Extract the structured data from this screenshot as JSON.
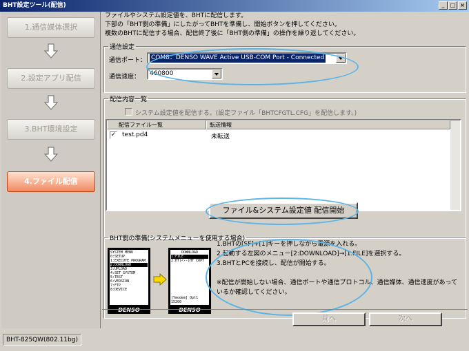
{
  "window": {
    "title": "BHT設定ツール(配信)"
  },
  "titlebar_buttons": [
    "_",
    "□",
    "×"
  ],
  "steps": [
    {
      "label": "1.通信媒体選択",
      "active": false
    },
    {
      "label": "2.設定アプリ配信",
      "active": false
    },
    {
      "label": "3.BHT環境設定",
      "active": false
    },
    {
      "label": "4.ファイル配信",
      "active": true
    }
  ],
  "intro": [
    "ファイルやシステム設定値を、BHTに配信します。",
    "下部の「BHT側の準備」にしたがってBHTを準備し、開始ボタンを押してください。",
    "複数のBHTに配信する場合、配信終了後に「BHT側の準備」の操作を繰り返してください。"
  ],
  "comm": {
    "legend": "通信設定",
    "port_label": "通信ポート：",
    "port_value": "COM8：DENSO WAVE Active USB-COM Port  - Connected",
    "speed_label": "通信速度：",
    "speed_value": "460800"
  },
  "delivery": {
    "legend": "配信内容一覧",
    "sys_checkbox_label": "システム設定値を配信する。(設定ファイル「BHTCFGTL.CFG」を配信します。)",
    "columns": [
      "配信ファイル一覧",
      "転送情報"
    ],
    "rows": [
      {
        "checked": true,
        "file": "test.pd4",
        "status": "未転送"
      }
    ]
  },
  "start_button": "ファイル&システム設定値 配信開始",
  "prep": {
    "legend": "BHT側の準備(システムメニューを使用する場合)",
    "menu_screen": [
      "SYSTEM MENU",
      "0:SETUP",
      "1:EXECUTE PROGRAM",
      "2:DOWNLOAD",
      "3:UPLOAD",
      "4:SET SYSTEM",
      "5:TEST",
      "6:VERSION",
      "7:FTP",
      "8:DEVICE"
    ],
    "download_screen": [
      "DOWNLOAD",
      "1:FILE",
      "2:HT(<--)HT COPY",
      "[Ymodem] Opt1 15200"
    ],
    "brand": "DENSO",
    "instructions": [
      "1.BHTの[SF]+[1]キーを押しながら電源を入れる。",
      "2.起動する左図のメニュー[2:DOWNLOAD]→[1.FILE]を選択する。",
      "3.BHTとPCを接続し、配信が開始する。",
      "",
      "※配信が開始しない場合、通信ポートや通信プロトコル、通信媒体、通信速度があって",
      "いるか確認してください。"
    ]
  },
  "nav": {
    "prev": "前へ",
    "next": "次へ"
  },
  "status": {
    "device": "BHT-825QW(802.11bg)"
  }
}
